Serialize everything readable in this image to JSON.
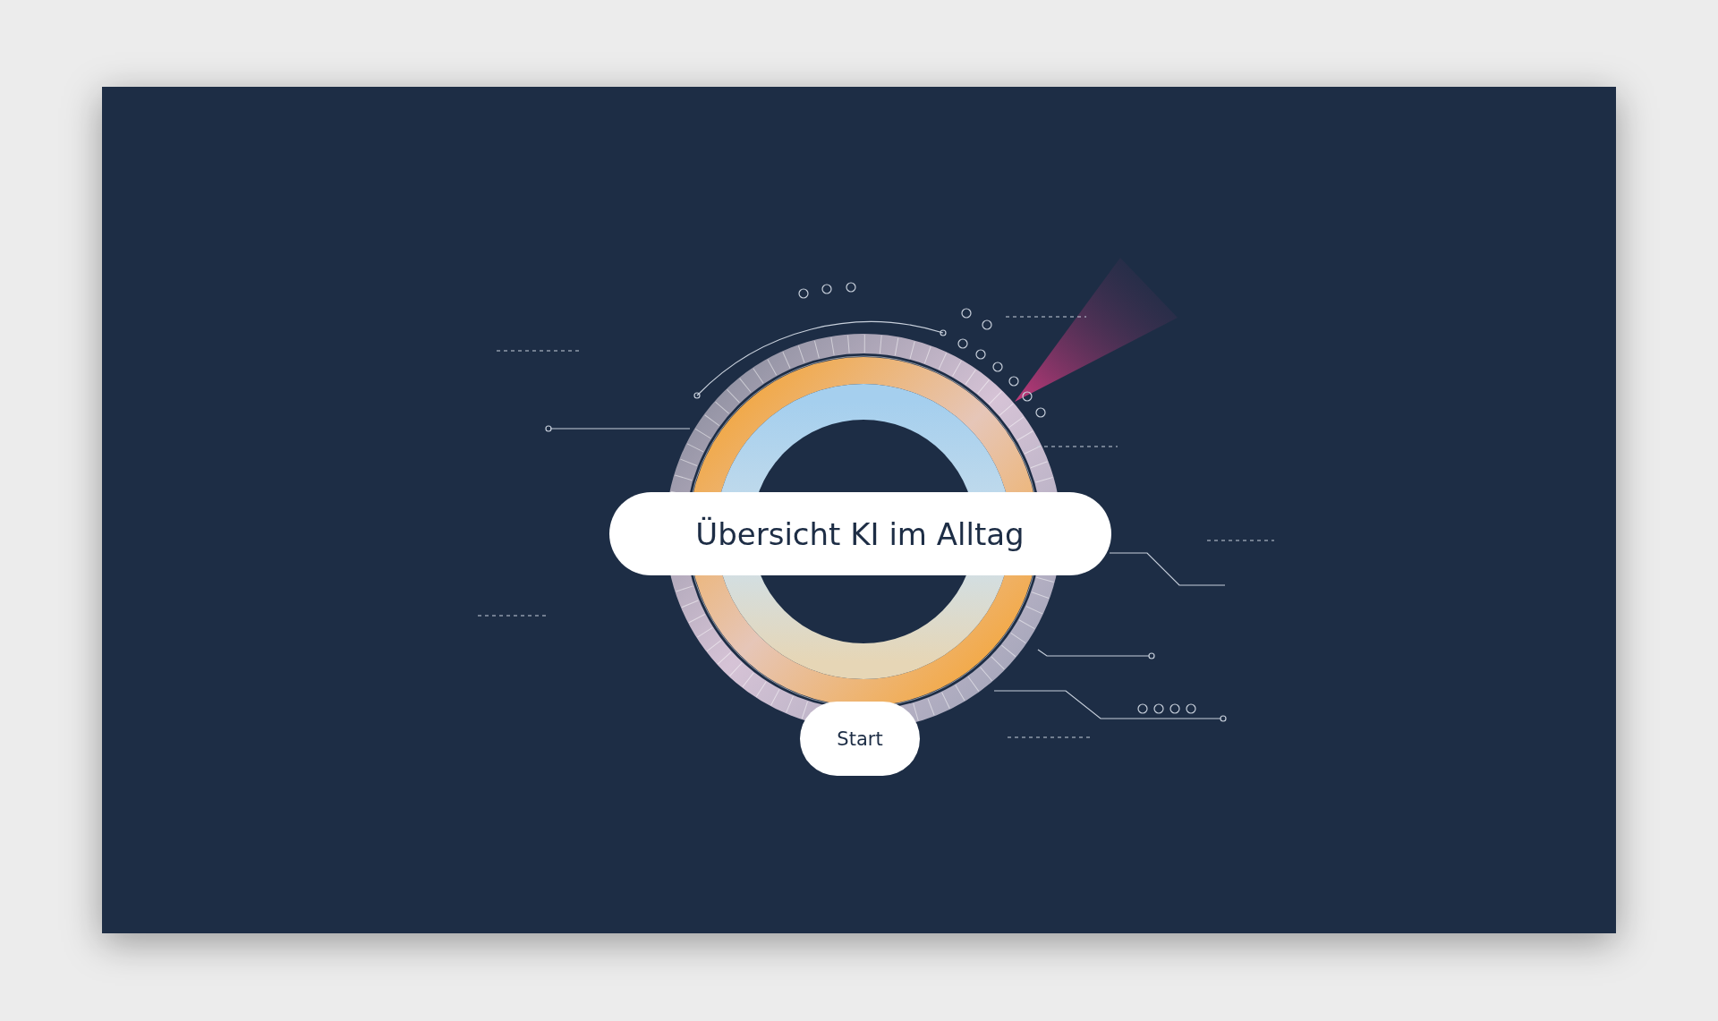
{
  "title": "Übersicht KI im Alltag",
  "start_button": {
    "label": "Start"
  }
}
